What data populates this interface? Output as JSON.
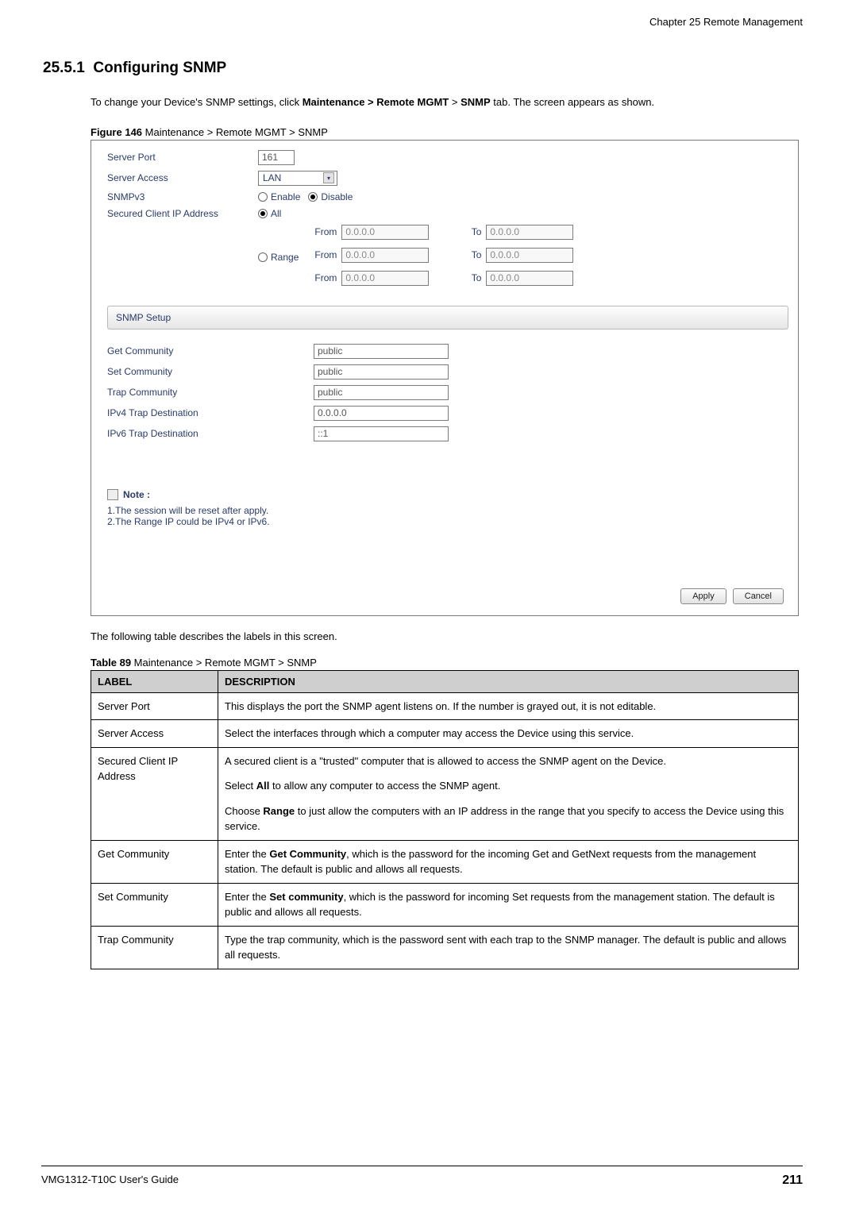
{
  "header": {
    "chapter": "Chapter 25 Remote Management"
  },
  "section": {
    "number": "25.5.1",
    "title": "Configuring SNMP",
    "intro_prefix": "To change your Device's SNMP settings, click ",
    "intro_bold": "Maintenance > Remote MGMT",
    "intro_mid": " > ",
    "intro_bold2": "SNMP",
    "intro_suffix": " tab. The screen appears as shown."
  },
  "figure": {
    "caption_bold": "Figure 146",
    "caption_rest": "   Maintenance > Remote MGMT > SNMP",
    "labels": {
      "server_port": "Server Port",
      "server_access": "Server Access",
      "snmpv3": "SNMPv3",
      "secured_client": "Secured Client IP Address",
      "enable": "Enable",
      "disable": "Disable",
      "all": "All",
      "range": "Range",
      "from": "From",
      "to": "To"
    },
    "values": {
      "server_port": "161",
      "server_access": "LAN",
      "ip_placeholder": "0.0.0.0"
    },
    "setup_bar": "SNMP Setup",
    "setup": {
      "get_community_label": "Get Community",
      "set_community_label": "Set Community",
      "trap_community_label": "Trap Community",
      "ipv4_trap_label": "IPv4 Trap Destination",
      "ipv6_trap_label": "IPv6 Trap Destination",
      "get_community": "public",
      "set_community": "public",
      "trap_community": "public",
      "ipv4_trap": "0.0.0.0",
      "ipv6_trap": "::1"
    },
    "note_title": "Note :",
    "note_line1": "1.The session will be reset after apply.",
    "note_line2": "2.The Range IP could be IPv4 or IPv6.",
    "apply": "Apply",
    "cancel": "Cancel"
  },
  "post_fig": "The following table describes the labels in this screen.",
  "table": {
    "caption_bold": "Table 89",
    "caption_rest": "   Maintenance > Remote MGMT > SNMP",
    "head_label": "LABEL",
    "head_desc": "DESCRIPTION",
    "rows": [
      {
        "label": "Server Port",
        "desc": [
          "This displays the port the SNMP agent listens on. If the number is grayed out, it is not editable."
        ]
      },
      {
        "label": "Server Access",
        "desc": [
          "Select the interfaces through which a computer may access the Device using this service."
        ]
      },
      {
        "label": "Secured Client IP Address",
        "desc_parts": [
          {
            "text": "A secured client is a \"trusted\" computer that is allowed to access the SNMP agent on the Device."
          },
          {
            "pre": "Select ",
            "bold": "All",
            "post": " to allow any computer to access the SNMP agent."
          },
          {
            "pre": "Choose ",
            "bold": "Range",
            "post": " to just allow the computers with an IP address in the range that you specify to access the Device using this service."
          }
        ]
      },
      {
        "label": "Get Community",
        "desc_parts": [
          {
            "pre": "Enter the ",
            "bold": "Get Community",
            "post": ", which is the password for the incoming Get and GetNext requests from the management station. The default is public and allows all requests."
          }
        ]
      },
      {
        "label": "Set Community",
        "desc_parts": [
          {
            "pre": " Enter the ",
            "bold": "Set community",
            "post": ", which is the password for incoming Set requests from the management station. The default is public and allows all requests."
          }
        ]
      },
      {
        "label": "Trap Community",
        "desc": [
          "Type the trap community, which is the password sent with each trap to the SNMP manager. The default is public and allows all requests."
        ]
      }
    ]
  },
  "footer": {
    "guide": "VMG1312-T10C User's Guide",
    "page": "211"
  }
}
